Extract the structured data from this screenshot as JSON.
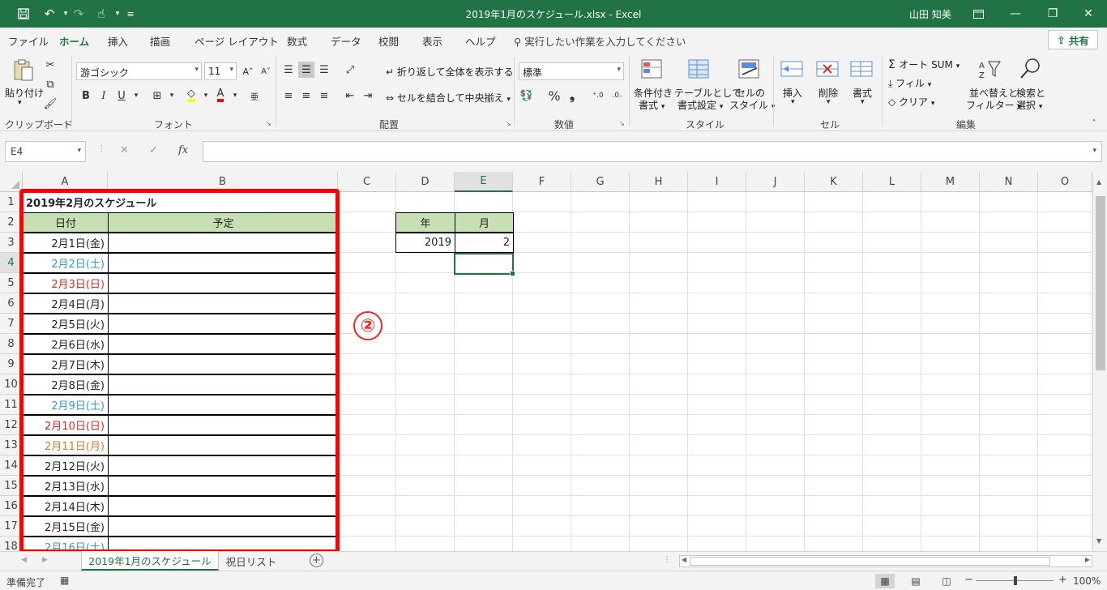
{
  "window": {
    "title": "2019年1月のスケジュール.xlsx  -  Excel",
    "user": "山田 知美"
  },
  "tabs": [
    "ファイル",
    "ホーム",
    "挿入",
    "描画",
    "ページ レイアウト",
    "数式",
    "データ",
    "校閲",
    "表示",
    "ヘルプ"
  ],
  "search_placeholder": "実行したい作業を入力してください",
  "share_label": "共有",
  "ribbon": {
    "clipboard": {
      "label": "クリップボード",
      "paste": "貼り付け"
    },
    "font": {
      "label": "フォント",
      "name": "游ゴシック",
      "size": "11"
    },
    "alignment": {
      "label": "配置",
      "wrap": "折り返して全体を表示する",
      "merge": "セルを結合して中央揃え"
    },
    "number": {
      "label": "数値",
      "format": "標準"
    },
    "styles": {
      "label": "スタイル",
      "cond1": "条件付き",
      "cond2": "書式",
      "table1": "テーブルとして",
      "table2": "書式設定",
      "cell1": "セルの",
      "cell2": "スタイル"
    },
    "cells": {
      "label": "セル",
      "insert": "挿入",
      "delete": "削除",
      "format": "書式"
    },
    "editing": {
      "label": "編集",
      "autosum": "オート SUM",
      "fill": "フィル",
      "clear": "クリア",
      "sort1": "並べ替えと",
      "sort2": "フィルター",
      "find1": "検索と",
      "find2": "選択"
    }
  },
  "formula_bar": {
    "name_box": "E4",
    "fx": "fx",
    "value": ""
  },
  "columns": [
    "A",
    "B",
    "C",
    "D",
    "E",
    "F",
    "G",
    "H",
    "I",
    "J",
    "K",
    "L",
    "M",
    "N",
    "O"
  ],
  "selected_column": "E",
  "rows": [
    "1",
    "2",
    "3",
    "4",
    "5",
    "6",
    "7",
    "8",
    "9",
    "10",
    "11",
    "12",
    "13",
    "14",
    "15",
    "16",
    "17",
    "18"
  ],
  "selected_row": "4",
  "sheet": {
    "a1_title": "2019年2月のスケジュール",
    "header_date": "日付",
    "header_plan": "予定",
    "dates": [
      {
        "text": "2月1日(金)",
        "kind": "weekday"
      },
      {
        "text": "2月2日(土)",
        "kind": "sat"
      },
      {
        "text": "2月3日(日)",
        "kind": "sun"
      },
      {
        "text": "2月4日(月)",
        "kind": "weekday"
      },
      {
        "text": "2月5日(火)",
        "kind": "weekday"
      },
      {
        "text": "2月6日(水)",
        "kind": "weekday"
      },
      {
        "text": "2月7日(木)",
        "kind": "weekday"
      },
      {
        "text": "2月8日(金)",
        "kind": "weekday"
      },
      {
        "text": "2月9日(土)",
        "kind": "sat"
      },
      {
        "text": "2月10日(日)",
        "kind": "sun"
      },
      {
        "text": "2月11日(月)",
        "kind": "hol"
      },
      {
        "text": "2月12日(火)",
        "kind": "weekday"
      },
      {
        "text": "2月13日(水)",
        "kind": "weekday"
      },
      {
        "text": "2月14日(木)",
        "kind": "weekday"
      },
      {
        "text": "2月15日(金)",
        "kind": "weekday"
      },
      {
        "text": "2月16日(土)",
        "kind": "sat"
      }
    ],
    "year_header": "年",
    "month_header": "月",
    "year_value": "2019",
    "month_value": "2"
  },
  "annotation_badge": "②",
  "sheet_tabs": [
    "2019年1月のスケジュール",
    "祝日リスト"
  ],
  "status": {
    "text": "準備完了",
    "zoom": "100%"
  }
}
